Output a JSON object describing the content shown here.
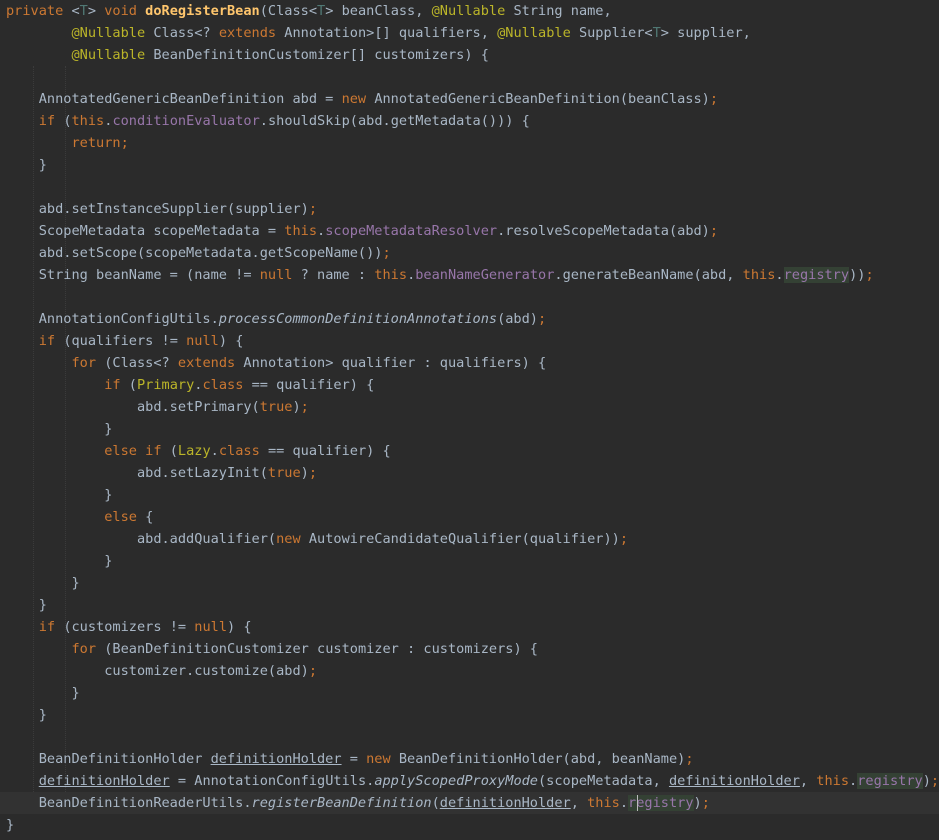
{
  "editor": {
    "language": "java",
    "current_line_index": 36,
    "caret_line_index": 36,
    "colors": {
      "background": "#2b2b2b",
      "current_line": "#323232",
      "default": "#a9b7c6",
      "keyword": "#cc7832",
      "annotation": "#bbb529",
      "field": "#9876aa",
      "method_decl": "#ffc66d",
      "type_param": "#507874",
      "registry_highlight": "#344134",
      "caret": "#bbbbbb"
    },
    "lines": [
      [
        [
          "private ",
          "kw"
        ],
        [
          "<",
          "d"
        ],
        [
          "T",
          "tp"
        ],
        [
          "> ",
          "d"
        ],
        [
          "void ",
          "kw"
        ],
        [
          "doRegisterBean",
          "md"
        ],
        [
          "(Class<",
          "d"
        ],
        [
          "T",
          "tp"
        ],
        [
          "> beanClass, ",
          "d"
        ],
        [
          "@Nullable ",
          "an"
        ],
        [
          "String name,",
          "d"
        ]
      ],
      [
        [
          "        ",
          "d"
        ],
        [
          "@Nullable ",
          "an"
        ],
        [
          "Class<? ",
          "d"
        ],
        [
          "extends ",
          "kw"
        ],
        [
          "Annotation>[] qualifiers, ",
          "d"
        ],
        [
          "@Nullable ",
          "an"
        ],
        [
          "Supplier<",
          "d"
        ],
        [
          "T",
          "tp"
        ],
        [
          "> supplier,",
          "d"
        ]
      ],
      [
        [
          "        ",
          "d"
        ],
        [
          "@Nullable ",
          "an"
        ],
        [
          "BeanDefinitionCustomizer[] customizers) {",
          "d"
        ]
      ],
      [],
      [
        [
          "    AnnotatedGenericBeanDefinition abd = ",
          "d"
        ],
        [
          "new ",
          "kw"
        ],
        [
          "AnnotatedGenericBeanDefinition(beanClass)",
          "d"
        ],
        [
          ";",
          "kw"
        ]
      ],
      [
        [
          "    ",
          "d"
        ],
        [
          "if ",
          "kw"
        ],
        [
          "(",
          "d"
        ],
        [
          "this",
          "kw"
        ],
        [
          ".",
          "d"
        ],
        [
          "conditionEvaluator",
          "fd"
        ],
        [
          ".shouldSkip(abd.getMetadata())) {",
          "d"
        ]
      ],
      [
        [
          "        ",
          "d"
        ],
        [
          "return;",
          "kw"
        ]
      ],
      [
        [
          "    }",
          "d"
        ]
      ],
      [],
      [
        [
          "    abd.setInstanceSupplier(supplier)",
          "d"
        ],
        [
          ";",
          "kw"
        ]
      ],
      [
        [
          "    ScopeMetadata scopeMetadata = ",
          "d"
        ],
        [
          "this",
          "kw"
        ],
        [
          ".",
          "d"
        ],
        [
          "scopeMetadataResolver",
          "fd"
        ],
        [
          ".resolveScopeMetadata(abd)",
          "d"
        ],
        [
          ";",
          "kw"
        ]
      ],
      [
        [
          "    abd.setScope(scopeMetadata.getScopeName())",
          "d"
        ],
        [
          ";",
          "kw"
        ]
      ],
      [
        [
          "    String beanName = (name != ",
          "d"
        ],
        [
          "null ",
          "kw"
        ],
        [
          "? name : ",
          "d"
        ],
        [
          "this",
          "kw"
        ],
        [
          ".",
          "d"
        ],
        [
          "beanNameGenerator",
          "fd"
        ],
        [
          ".generateBeanName(abd, ",
          "d"
        ],
        [
          "this",
          "kw"
        ],
        [
          ".",
          "d"
        ],
        [
          "registry",
          "fh"
        ],
        [
          "))",
          "d"
        ],
        [
          ";",
          "kw"
        ]
      ],
      [],
      [
        [
          "    AnnotationConfigUtils.",
          "d"
        ],
        [
          "processCommonDefinitionAnnotations",
          "it"
        ],
        [
          "(abd)",
          "d"
        ],
        [
          ";",
          "kw"
        ]
      ],
      [
        [
          "    ",
          "d"
        ],
        [
          "if ",
          "kw"
        ],
        [
          "(qualifiers != ",
          "d"
        ],
        [
          "null",
          "kw"
        ],
        [
          ") {",
          "d"
        ]
      ],
      [
        [
          "        ",
          "d"
        ],
        [
          "for ",
          "kw"
        ],
        [
          "(Class<? ",
          "d"
        ],
        [
          "extends ",
          "kw"
        ],
        [
          "Annotation> qualifier : qualifiers) {",
          "d"
        ]
      ],
      [
        [
          "            ",
          "d"
        ],
        [
          "if ",
          "kw"
        ],
        [
          "(",
          "d"
        ],
        [
          "Primary",
          "an"
        ],
        [
          ".",
          "d"
        ],
        [
          "class ",
          "kw"
        ],
        [
          "== qualifier) {",
          "d"
        ]
      ],
      [
        [
          "                abd.setPrimary(",
          "d"
        ],
        [
          "true",
          "kw"
        ],
        [
          ")",
          "d"
        ],
        [
          ";",
          "kw"
        ]
      ],
      [
        [
          "            }",
          "d"
        ]
      ],
      [
        [
          "            ",
          "d"
        ],
        [
          "else if ",
          "kw"
        ],
        [
          "(",
          "d"
        ],
        [
          "Lazy",
          "an"
        ],
        [
          ".",
          "d"
        ],
        [
          "class ",
          "kw"
        ],
        [
          "== qualifier) {",
          "d"
        ]
      ],
      [
        [
          "                abd.setLazyInit(",
          "d"
        ],
        [
          "true",
          "kw"
        ],
        [
          ")",
          "d"
        ],
        [
          ";",
          "kw"
        ]
      ],
      [
        [
          "            }",
          "d"
        ]
      ],
      [
        [
          "            ",
          "d"
        ],
        [
          "else ",
          "kw"
        ],
        [
          "{",
          "d"
        ]
      ],
      [
        [
          "                abd.addQualifier(",
          "d"
        ],
        [
          "new ",
          "kw"
        ],
        [
          "AutowireCandidateQualifier(qualifier))",
          "d"
        ],
        [
          ";",
          "kw"
        ]
      ],
      [
        [
          "            }",
          "d"
        ]
      ],
      [
        [
          "        }",
          "d"
        ]
      ],
      [
        [
          "    }",
          "d"
        ]
      ],
      [
        [
          "    ",
          "d"
        ],
        [
          "if ",
          "kw"
        ],
        [
          "(customizers != ",
          "d"
        ],
        [
          "null",
          "kw"
        ],
        [
          ") {",
          "d"
        ]
      ],
      [
        [
          "        ",
          "d"
        ],
        [
          "for ",
          "kw"
        ],
        [
          "(BeanDefinitionCustomizer customizer : customizers) {",
          "d"
        ]
      ],
      [
        [
          "            customizer.customize(abd)",
          "d"
        ],
        [
          ";",
          "kw"
        ]
      ],
      [
        [
          "        }",
          "d"
        ]
      ],
      [
        [
          "    }",
          "d"
        ]
      ],
      [],
      [
        [
          "    BeanDefinitionHolder ",
          "d"
        ],
        [
          "definitionHolder",
          "ul"
        ],
        [
          " = ",
          "d"
        ],
        [
          "new ",
          "kw"
        ],
        [
          "BeanDefinitionHolder(abd, beanName)",
          "d"
        ],
        [
          ";",
          "kw"
        ]
      ],
      [
        [
          "    ",
          "d"
        ],
        [
          "definitionHolder",
          "ul"
        ],
        [
          " = AnnotationConfigUtils.",
          "d"
        ],
        [
          "applyScopedProxyMode",
          "it"
        ],
        [
          "(scopeMetadata, ",
          "d"
        ],
        [
          "definitionHolder",
          "ul"
        ],
        [
          ", ",
          "d"
        ],
        [
          "this",
          "kw"
        ],
        [
          ".",
          "d"
        ],
        [
          "registry",
          "fh"
        ],
        [
          ")",
          "d"
        ],
        [
          ";",
          "kw"
        ]
      ],
      [
        [
          "    BeanDefinitionReaderUtils.",
          "d"
        ],
        [
          "registerBeanDefinition",
          "it"
        ],
        [
          "(",
          "d"
        ],
        [
          "definitionHolder",
          "ul"
        ],
        [
          ", ",
          "d"
        ],
        [
          "this",
          "kw"
        ],
        [
          ".",
          "d"
        ],
        [
          "registry",
          "fh"
        ],
        [
          ")",
          "d"
        ],
        [
          ";",
          "kw"
        ]
      ],
      [
        [
          "}",
          "d"
        ]
      ]
    ]
  }
}
